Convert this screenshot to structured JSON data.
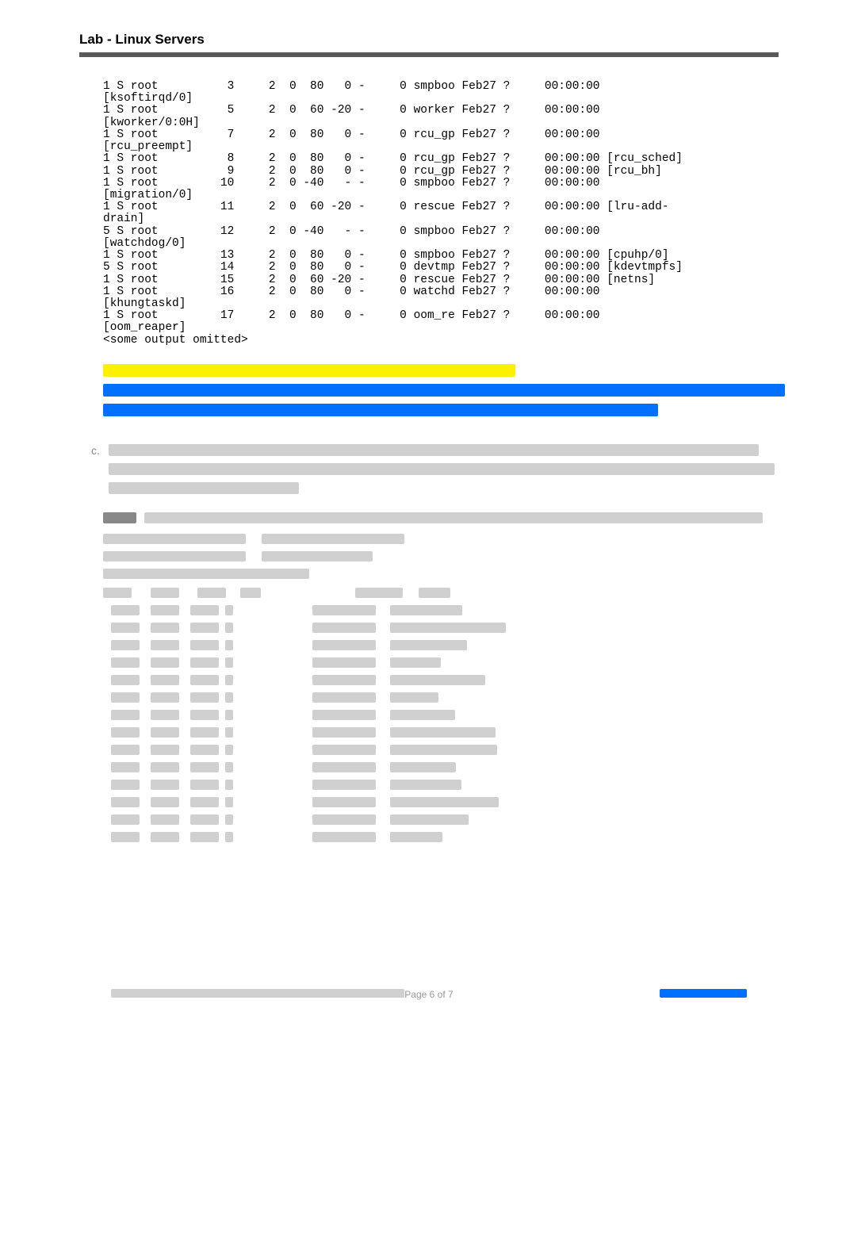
{
  "header": {
    "title": "Lab - Linux Servers"
  },
  "ps_rows": [
    {
      "c1": "1 S root",
      "pid": "3",
      "ppid": "2",
      "c": "0",
      "pri": "80",
      "ni": "0",
      "dash": "-",
      "sz": "0",
      "wchan": "smpboo",
      "stime": "Feb27",
      "tty": "?",
      "time": "00:00:00",
      "cmd": "",
      "name": "[ksoftirqd/0]"
    },
    {
      "c1": "1 S root",
      "pid": "5",
      "ppid": "2",
      "c": "0",
      "pri": "60",
      "ni": "-20",
      "dash": "-",
      "sz": "0",
      "wchan": "worker",
      "stime": "Feb27",
      "tty": "?",
      "time": "00:00:00",
      "cmd": "",
      "name": "[kworker/0:0H]"
    },
    {
      "c1": "1 S root",
      "pid": "7",
      "ppid": "2",
      "c": "0",
      "pri": "80",
      "ni": "0",
      "dash": "-",
      "sz": "0",
      "wchan": "rcu_gp",
      "stime": "Feb27",
      "tty": "?",
      "time": "00:00:00",
      "cmd": "",
      "name": "[rcu_preempt]"
    },
    {
      "c1": "1 S root",
      "pid": "8",
      "ppid": "2",
      "c": "0",
      "pri": "80",
      "ni": "0",
      "dash": "-",
      "sz": "0",
      "wchan": "rcu_gp",
      "stime": "Feb27",
      "tty": "?",
      "time": "00:00:00",
      "cmd": "[rcu_sched]",
      "name": ""
    },
    {
      "c1": "1 S root",
      "pid": "9",
      "ppid": "2",
      "c": "0",
      "pri": "80",
      "ni": "0",
      "dash": "-",
      "sz": "0",
      "wchan": "rcu_gp",
      "stime": "Feb27",
      "tty": "?",
      "time": "00:00:00",
      "cmd": "[rcu_bh]",
      "name": ""
    },
    {
      "c1": "1 S root",
      "pid": "10",
      "ppid": "2",
      "c": "0",
      "pri": "-40",
      "ni": "-",
      "dash": "-",
      "sz": "0",
      "wchan": "smpboo",
      "stime": "Feb27",
      "tty": "?",
      "time": "00:00:00",
      "cmd": "",
      "name": "[migration/0]"
    },
    {
      "c1": "1 S root",
      "pid": "11",
      "ppid": "2",
      "c": "0",
      "pri": "60",
      "ni": "-20",
      "dash": "-",
      "sz": "0",
      "wchan": "rescue",
      "stime": "Feb27",
      "tty": "?",
      "time": "00:00:00",
      "cmd": "[lru-add-",
      "name": "drain]"
    },
    {
      "c1": "5 S root",
      "pid": "12",
      "ppid": "2",
      "c": "0",
      "pri": "-40",
      "ni": "-",
      "dash": "-",
      "sz": "0",
      "wchan": "smpboo",
      "stime": "Feb27",
      "tty": "?",
      "time": "00:00:00",
      "cmd": "",
      "name": "[watchdog/0]"
    },
    {
      "c1": "1 S root",
      "pid": "13",
      "ppid": "2",
      "c": "0",
      "pri": "80",
      "ni": "0",
      "dash": "-",
      "sz": "0",
      "wchan": "smpboo",
      "stime": "Feb27",
      "tty": "?",
      "time": "00:00:00",
      "cmd": "[cpuhp/0]",
      "name": ""
    },
    {
      "c1": "5 S root",
      "pid": "14",
      "ppid": "2",
      "c": "0",
      "pri": "80",
      "ni": "0",
      "dash": "-",
      "sz": "0",
      "wchan": "devtmp",
      "stime": "Feb27",
      "tty": "?",
      "time": "00:00:00",
      "cmd": "[kdevtmpfs]",
      "name": ""
    },
    {
      "c1": "1 S root",
      "pid": "15",
      "ppid": "2",
      "c": "0",
      "pri": "60",
      "ni": "-20",
      "dash": "-",
      "sz": "0",
      "wchan": "rescue",
      "stime": "Feb27",
      "tty": "?",
      "time": "00:00:00",
      "cmd": "[netns]",
      "name": ""
    },
    {
      "c1": "1 S root",
      "pid": "16",
      "ppid": "2",
      "c": "0",
      "pri": "80",
      "ni": "0",
      "dash": "-",
      "sz": "0",
      "wchan": "watchd",
      "stime": "Feb27",
      "tty": "?",
      "time": "00:00:00",
      "cmd": "",
      "name": "[khungtaskd]"
    },
    {
      "c1": "1 S root",
      "pid": "17",
      "ppid": "2",
      "c": "0",
      "pri": "80",
      "ni": "0",
      "dash": "-",
      "sz": "0",
      "wchan": "oom_re",
      "stime": "Feb27",
      "tty": "?",
      "time": "00:00:00",
      "cmd": "",
      "name": "[oom_reaper]"
    }
  ],
  "omitted": "<some output omitted>",
  "footer": {
    "page": "Page 6 of 7"
  }
}
